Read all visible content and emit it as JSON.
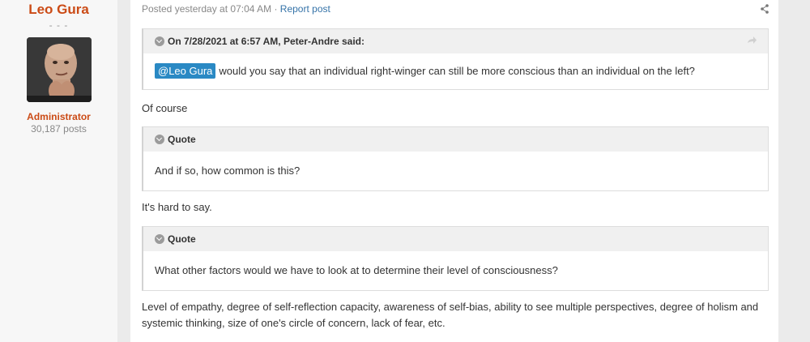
{
  "author": {
    "name": "Leo Gura",
    "dots": "- - -",
    "role": "Administrator",
    "posts": "30,187 posts"
  },
  "post": {
    "posted": "Posted yesterday at 07:04 AM",
    "separator": "·",
    "report": "Report post",
    "quote1": {
      "header": "On 7/28/2021 at 6:57 AM, Peter-Andre said:",
      "mention": "@Leo Gura",
      "text": "would you say that an individual right-winger can still be more conscious than an individual on the left?"
    },
    "reply1": "Of course",
    "quote2": {
      "header": "Quote",
      "text": "And if so, how common is this?"
    },
    "reply2": "It's hard to say.",
    "quote3": {
      "header": "Quote",
      "text": "What other factors would we have to look at to determine their level of consciousness?"
    },
    "reply3_line1": "Level of empathy, degree of self-reflection capacity, awareness of self-bias, ability to see multiple perspectives, degree of holism and",
    "reply3_line2": "systemic thinking, size of one's circle of concern, lack of fear, etc."
  },
  "colors": {
    "accent": "#cb4b16",
    "link": "#3573a8",
    "mention_bg": "#2a89c4"
  },
  "icons": [
    "share-icon",
    "chevron-down-icon",
    "reply-arrow-icon"
  ]
}
